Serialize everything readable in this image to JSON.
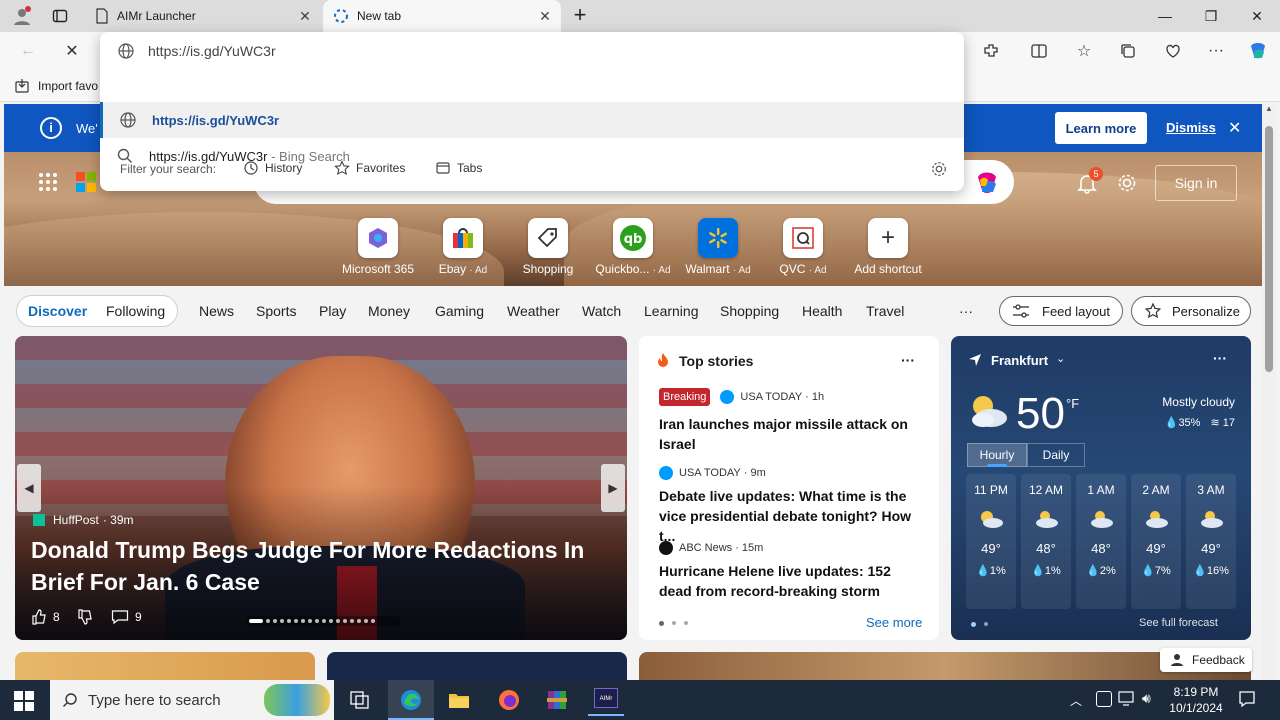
{
  "tabs": [
    {
      "title": "AIMr Launcher"
    },
    {
      "title": "New tab"
    }
  ],
  "address": {
    "value": "https://is.gd/YuWC3r"
  },
  "suggestions": [
    {
      "text": "https://is.gd/YuWC3r",
      "type": "url"
    },
    {
      "text": "https://is.gd/YuWC3r",
      "suffix": " - Bing Search",
      "type": "search"
    }
  ],
  "filter": {
    "label": "Filter your search:",
    "options": [
      "History",
      "Favorites",
      "Tabs"
    ]
  },
  "favorites_bar": {
    "import_label": "Import favo"
  },
  "infobar": {
    "text": "We'",
    "learn_more": "Learn more",
    "dismiss": "Dismiss"
  },
  "header": {
    "notification_count": "5",
    "sign_in": "Sign in"
  },
  "quick_links": [
    {
      "label": "Microsoft 365",
      "ad": ""
    },
    {
      "label": "Ebay",
      "ad": "· Ad"
    },
    {
      "label": "Shopping",
      "ad": ""
    },
    {
      "label": "Quickbo...",
      "ad": "· Ad"
    },
    {
      "label": "Walmart",
      "ad": "· Ad"
    },
    {
      "label": "QVC",
      "ad": "· Ad"
    },
    {
      "label": "Add shortcut",
      "ad": ""
    }
  ],
  "nav": {
    "discover": "Discover",
    "following": "Following",
    "items": [
      "News",
      "Sports",
      "Play",
      "Money",
      "Gaming",
      "Weather",
      "Watch",
      "Learning",
      "Shopping",
      "Health",
      "Travel"
    ],
    "more": "···",
    "feed_layout": "Feed layout",
    "personalize": "Personalize"
  },
  "lead_story": {
    "source": "HuffPost",
    "time": "· 39m",
    "headline": "Donald Trump Begs Judge For More Redactions In Brief For Jan. 6 Case",
    "likes": "8",
    "comments": "9"
  },
  "top_stories": {
    "title": "Top stories",
    "more": "···",
    "items": [
      {
        "badge": "Breaking",
        "source": "USA TODAY",
        "time": "· 1h",
        "headline": "Iran launches major missile attack on Israel"
      },
      {
        "badge": "",
        "source": "USA TODAY",
        "time": "· 9m",
        "headline": "Debate live updates: What time is the vice presidential debate tonight? How t..."
      },
      {
        "badge": "",
        "source": "ABC News",
        "time": "· 15m",
        "headline": "Hurricane Helene live updates: 152 dead from record-breaking storm"
      }
    ],
    "see_more": "See more"
  },
  "weather": {
    "location": "Frankfurt",
    "temp": "50",
    "unit": "°F",
    "condition": "Mostly cloudy",
    "humidity": "35%",
    "wind": "17",
    "tabs": [
      "Hourly",
      "Daily"
    ],
    "hours": [
      {
        "time": "11 PM",
        "temp": "49°",
        "precip": "1%"
      },
      {
        "time": "12 AM",
        "temp": "48°",
        "precip": "1%"
      },
      {
        "time": "1 AM",
        "temp": "48°",
        "precip": "2%"
      },
      {
        "time": "2 AM",
        "temp": "49°",
        "precip": "7%"
      },
      {
        "time": "3 AM",
        "temp": "49°",
        "precip": "16%"
      }
    ],
    "full_forecast": "See full forecast"
  },
  "feedback": "Feedback",
  "taskbar": {
    "search_placeholder": "Type here to search",
    "time": "8:19 PM",
    "date": "10/1/2024"
  },
  "colors": {
    "accent": "#0f6cbd",
    "infobar": "#0f56c0",
    "breaking": "#c4262e"
  }
}
